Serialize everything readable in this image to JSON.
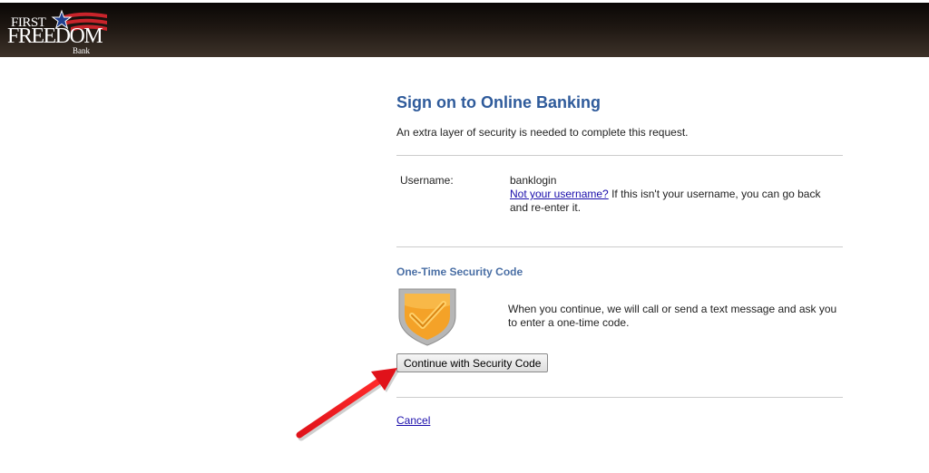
{
  "bank": {
    "logo_first": "FIRST",
    "logo_freedom": "FREEDOM",
    "logo_bank": "Bank"
  },
  "page": {
    "title": "Sign on to Online Banking",
    "subtitle": "An extra layer of security is needed to complete this request."
  },
  "username": {
    "label": "Username:",
    "value": "banklogin",
    "not_yours_link": "Not your username?",
    "help_text": " If this isn't your username, you can go back and re-enter it."
  },
  "security_code": {
    "heading": "One-Time Security Code",
    "description": "When you continue, we will call or send a text message and ask you to enter a one-time code.",
    "continue_button": "Continue with Security Code"
  },
  "cancel_link": "Cancel",
  "colors": {
    "title": "#2f5b9b",
    "header": "#1e1712",
    "shield_orange": "#f4a228",
    "arrow_red": "#e0121a"
  }
}
